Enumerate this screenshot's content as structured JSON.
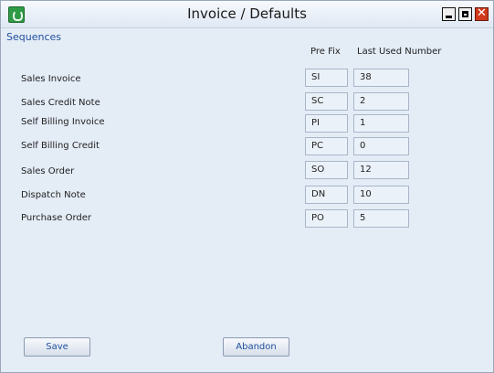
{
  "window": {
    "title": "Invoice / Defaults",
    "icons": {
      "app": "app-icon",
      "minimize": "minimize-icon",
      "maximize": "maximize-icon",
      "close": "close-icon"
    },
    "close_glyph": "✕"
  },
  "section": {
    "label": "Sequences"
  },
  "columns": {
    "prefix": "Pre Fix",
    "last_used": "Last Used Number"
  },
  "rows": [
    {
      "label": "Sales Invoice",
      "prefix": "SI",
      "last_used": "38"
    },
    {
      "label": "Sales Credit Note",
      "prefix": "SC",
      "last_used": "2"
    },
    {
      "label": "Self Billing Invoice",
      "prefix": "PI",
      "last_used": "1"
    },
    {
      "label": "Self Billing Credit",
      "prefix": "PC",
      "last_used": "0"
    },
    {
      "label": "Sales Order",
      "prefix": "SO",
      "last_used": "12"
    },
    {
      "label": "Dispatch Note",
      "prefix": "DN",
      "last_used": "10"
    },
    {
      "label": "Purchase Order",
      "prefix": "PO",
      "last_used": "5"
    }
  ],
  "buttons": {
    "save": "Save",
    "abandon": "Abandon"
  },
  "colors": {
    "accent": "#1f4f9c",
    "close": "#d03a1c",
    "background": "#e4ecf6"
  }
}
